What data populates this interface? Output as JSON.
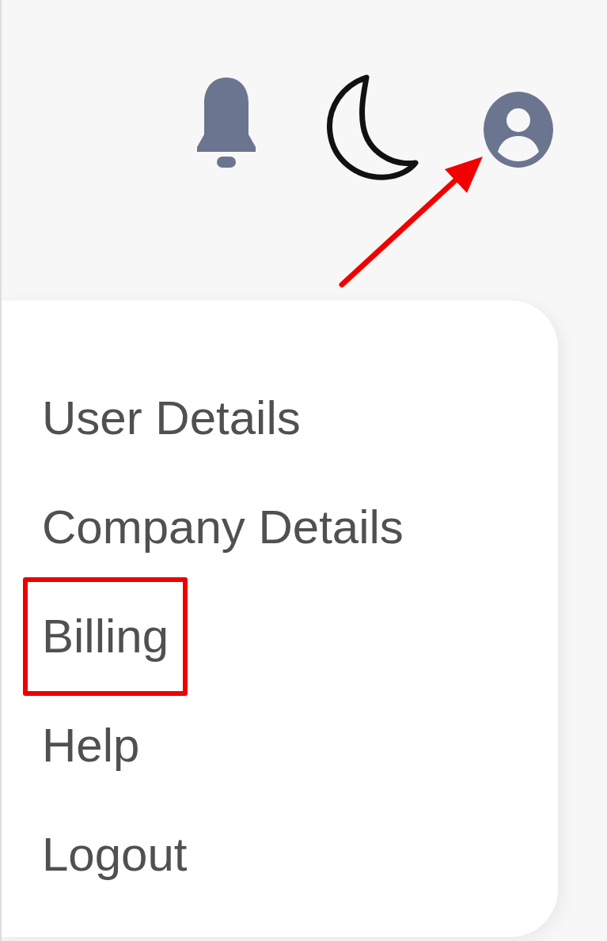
{
  "menu": {
    "items": [
      {
        "label": "User Details",
        "highlighted": false
      },
      {
        "label": "Company Details",
        "highlighted": false
      },
      {
        "label": "Billing",
        "highlighted": true
      },
      {
        "label": "Help",
        "highlighted": false
      },
      {
        "label": "Logout",
        "highlighted": false
      }
    ]
  }
}
